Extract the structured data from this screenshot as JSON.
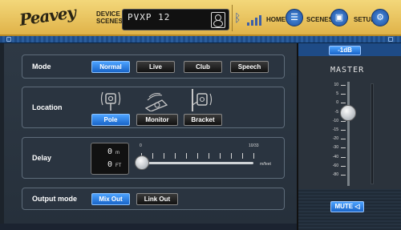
{
  "header": {
    "logo": "Peavey",
    "device_scenes_label": "DEVICE SCENES",
    "device_name": "PVXP 12",
    "nav": {
      "home": "HOME",
      "scenes": "SCENES",
      "setup": "SETUP"
    }
  },
  "mode": {
    "label": "Mode",
    "options": [
      "Normal",
      "Live",
      "Club",
      "Speech"
    ],
    "selected": "Normal"
  },
  "location": {
    "label": "Location",
    "options": [
      "Pole",
      "Monitor",
      "Bracket"
    ],
    "selected": "Pole"
  },
  "delay": {
    "label": "Delay",
    "meters_value": "0",
    "meters_unit": "m",
    "feet_value": "0",
    "feet_unit": "FT",
    "slider_min_label": "0",
    "slider_max_label": "10/33",
    "slider_unit_label": "m/feet",
    "slider_fraction": 0.0
  },
  "output_mode": {
    "label": "Output mode",
    "options": [
      "Mix Out",
      "Link Out"
    ],
    "selected": "Mix Out"
  },
  "master": {
    "level_label": "-1dB",
    "title": "MASTER",
    "scale": [
      "10",
      "5",
      "0",
      "-5",
      "-10",
      "-15",
      "-20",
      "-30",
      "-40",
      "-60",
      "-80"
    ],
    "mute_label": "MUTE"
  },
  "colors": {
    "accent_blue": "#1965c9",
    "header_gold": "#e0b349"
  },
  "icons": {
    "bluetooth": "bluetooth-icon",
    "signal": "signal-strength-icon",
    "home": "home-icon",
    "scenes": "scenes-icon",
    "setup": "gear-icon",
    "speaker": "speaker-icon",
    "mute": "speaker-mute-icon"
  }
}
